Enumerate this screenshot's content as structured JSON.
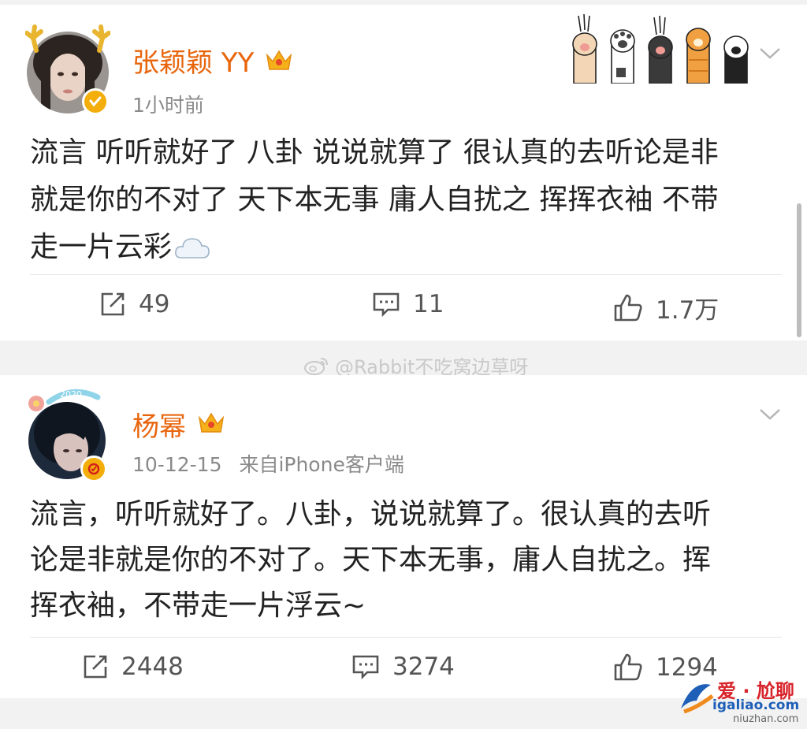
{
  "post1": {
    "username": "张颖颖 YY",
    "time": "1小时前",
    "lines": [
      "流言 听听就好了 八卦 说说就算了 很认真的去听论是非",
      "就是你的不对了 天下本无事 庸人自扰之 挥挥衣袖 不带",
      "走一片云彩"
    ],
    "emoji": "cloud-emoji",
    "repost_count": "49",
    "comment_count": "11",
    "like_count": "1.7万"
  },
  "watermark": "@Rabbit不吃窝边草呀",
  "post2": {
    "username": "杨幂",
    "time": "10-12-15",
    "source": "来自iPhone客户端",
    "lines": [
      "流言，听听就好了。八卦，说说就算了。很认真的去听",
      "论是非就是你的不对了。天下本无事，庸人自扰之。挥",
      "挥衣袖，不带走一片浮云~"
    ],
    "repost_count": "2448",
    "comment_count": "3274",
    "like_count": "1294"
  },
  "site_logo": {
    "name": "爱 · 尬聊",
    "domain": "igaliao.com",
    "sub": "niuzhan.com"
  },
  "colors": {
    "username": "#e8650c",
    "verified_badge": "#f3ae0c",
    "meta_gray": "#8a8a8a"
  }
}
